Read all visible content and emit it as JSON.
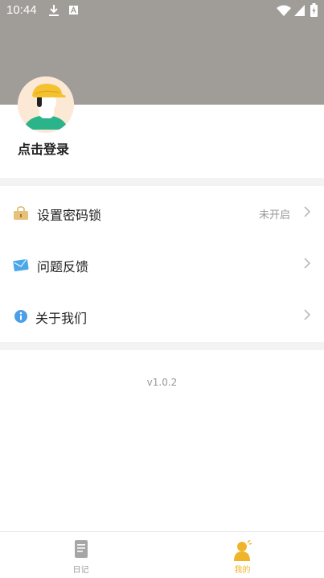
{
  "status_bar": {
    "time": "10:44"
  },
  "profile": {
    "login_label": "点击登录"
  },
  "menu": [
    {
      "label": "设置密码锁",
      "status": "未开启"
    },
    {
      "label": "问题反馈",
      "status": ""
    },
    {
      "label": "关于我们",
      "status": ""
    }
  ],
  "version": "v1.0.2",
  "tabs": [
    {
      "label": "日记",
      "active": false
    },
    {
      "label": "我的",
      "active": true
    }
  ],
  "colors": {
    "header": "#a09c98",
    "accent": "#f0b429",
    "inactive": "#9a9a9a",
    "chevron": "#b8b8b8"
  }
}
